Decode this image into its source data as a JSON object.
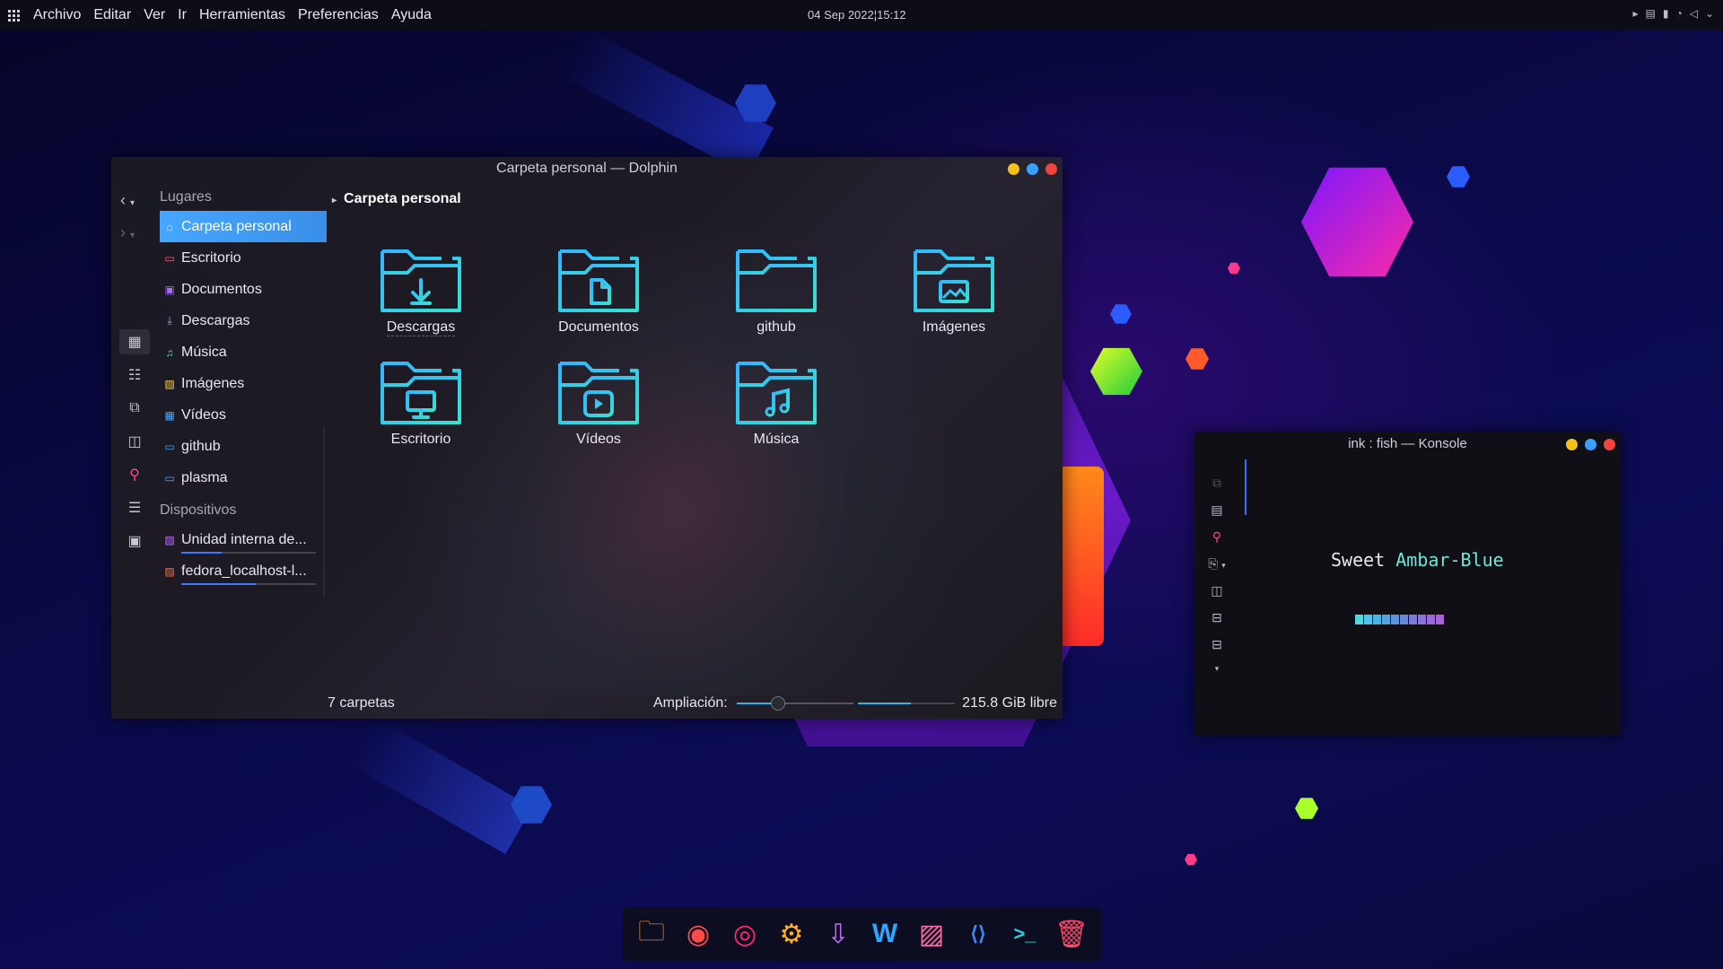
{
  "topbar": {
    "menu": [
      "Archivo",
      "Editar",
      "Ver",
      "Ir",
      "Herramientas",
      "Preferencias",
      "Ayuda"
    ],
    "clock": "04 Sep 2022¦15:12",
    "tray_icons": [
      "play-icon",
      "clipboard-icon",
      "battery-icon",
      "network-icon",
      "volume-icon",
      "chevron-down-icon"
    ]
  },
  "dolphin": {
    "title": "Carpeta personal — Dolphin",
    "places_header": "Lugares",
    "places": [
      {
        "label": "Carpeta personal",
        "icon": "home-icon",
        "color": "#7fd4ff"
      },
      {
        "label": "Escritorio",
        "icon": "desktop-icon",
        "color": "#ff5c6a"
      },
      {
        "label": "Documentos",
        "icon": "documents-icon",
        "color": "#b06bff"
      },
      {
        "label": "Descargas",
        "icon": "downloads-icon",
        "color": "#c78cff"
      },
      {
        "label": "Música",
        "icon": "music-icon",
        "color": "#55e6a8"
      },
      {
        "label": "Imágenes",
        "icon": "images-icon",
        "color": "#ffcc55"
      },
      {
        "label": "Vídeos",
        "icon": "videos-icon",
        "color": "#4aa8ff"
      },
      {
        "label": "github",
        "icon": "folder-icon",
        "color": "#4aa8ff"
      },
      {
        "label": "plasma",
        "icon": "folder-icon",
        "color": "#4aa8ff"
      }
    ],
    "devices_header": "Dispositivos",
    "devices": [
      {
        "label": "Unidad interna de...",
        "icon": "drive-icon",
        "usage": 0.3
      },
      {
        "label": "fedora_localhost-l...",
        "icon": "drive-icon",
        "usage": 0.55
      }
    ],
    "breadcrumb": "Carpeta personal",
    "folders": [
      {
        "label": "Descargas",
        "glyph": "download"
      },
      {
        "label": "Documentos",
        "glyph": "document"
      },
      {
        "label": "github",
        "glyph": "none"
      },
      {
        "label": "Imágenes",
        "glyph": "image"
      },
      {
        "label": "Escritorio",
        "glyph": "desktop"
      },
      {
        "label": "Vídeos",
        "glyph": "video"
      },
      {
        "label": "Música",
        "glyph": "music"
      }
    ],
    "status": {
      "count": "7 carpetas",
      "zoom_label": "Ampliación:",
      "zoom_level": 0.35,
      "free": "215.8 GiB libre",
      "free_used": 0.55
    }
  },
  "konsole": {
    "title": "ink : fish — Konsole",
    "line_word1": "Sweet",
    "line_word2": "Ambar-Blue",
    "swatches": [
      "#56d6e0",
      "#4fc4e6",
      "#4ab4e4",
      "#54a4de",
      "#5e96da",
      "#6b88d8",
      "#7a7cd6",
      "#8a72d6",
      "#9a6ad6",
      "#a864d4"
    ]
  },
  "dock": [
    "folder-icon",
    "chrome-icon",
    "media-icon",
    "settings-icon",
    "discover-icon",
    "writer-icon",
    "image-viewer-icon",
    "vscode-icon",
    "terminal-icon",
    "trash-icon"
  ],
  "colors": {
    "accent": "#3daee9",
    "btn_min": "#f4c21a",
    "btn_max": "#3aa0ff",
    "btn_close": "#f0453f",
    "folder_a": "#32b6ff",
    "folder_b": "#38e0d0"
  }
}
